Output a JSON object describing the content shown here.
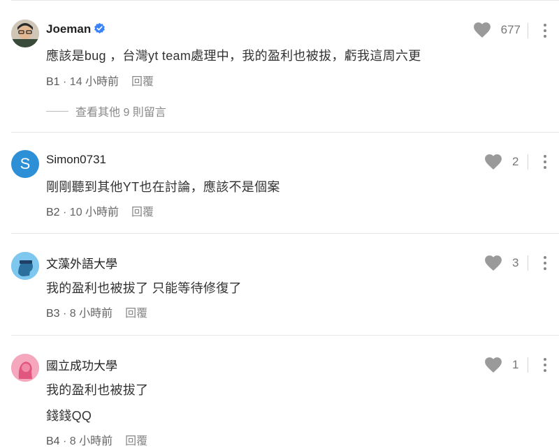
{
  "comments": [
    {
      "name": "Joeman",
      "verified": true,
      "text": "應該是bug ，台灣yt team處理中，我的盈利也被拔，虧我這周六更",
      "floor": "B1",
      "time": "14 小時前",
      "reply": "回覆",
      "likes": "677",
      "view_replies": "查看其他 9 則留言"
    },
    {
      "name": "Simon0731",
      "avatar_letter": "S",
      "text": "剛剛聽到其他YT也在討論，應該不是個案",
      "floor": "B2",
      "time": "10 小時前",
      "reply": "回覆",
      "likes": "2"
    },
    {
      "name": "文藻外語大學",
      "text": "我的盈利也被拔了 只能等待修復了",
      "floor": "B3",
      "time": "8 小時前",
      "reply": "回覆",
      "likes": "3"
    },
    {
      "name": "國立成功大學",
      "text_lines": [
        "我的盈利也被拔了",
        "錢錢QQ"
      ],
      "floor": "B4",
      "time": "8 小時前",
      "reply": "回覆",
      "likes": "1"
    }
  ],
  "colors": {
    "verified": "#3b82f6",
    "avatar_s": "#2d8fd5",
    "avatar_b3": "#7ec8f0",
    "avatar_b4": "#f4a7bd",
    "heart": "#9a9a9a"
  }
}
